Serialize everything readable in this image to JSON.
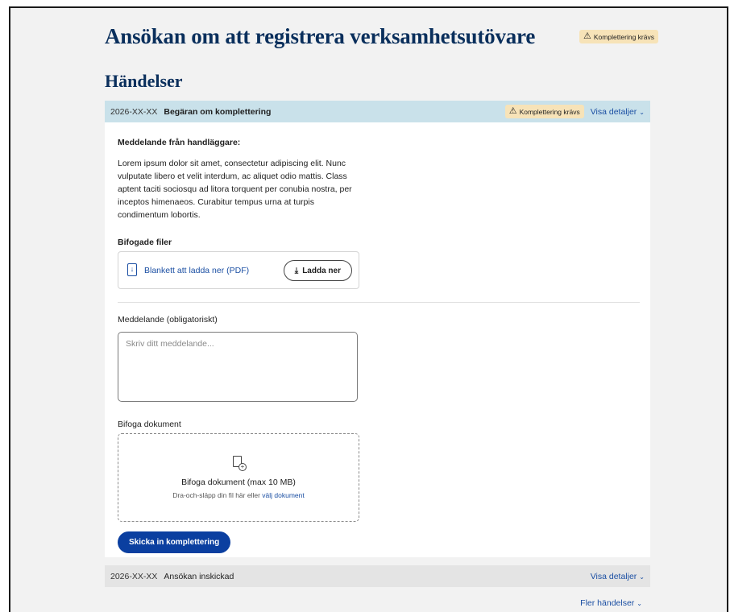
{
  "page": {
    "title": "Ansökan om att registrera verksamhetsutövare",
    "status_badge": "Komplettering krävs"
  },
  "events_section": {
    "title": "Händelser",
    "events": [
      {
        "date": "2026-XX-XX",
        "title": "Begäran om komplettering",
        "badge": "Komplettering krävs",
        "toggle_label": "Visa detaljer"
      },
      {
        "date": "2026-XX-XX",
        "title": "Ansökan inskickad",
        "toggle_label": "Visa detaljer"
      }
    ],
    "more_label": "Fler händelser"
  },
  "detail": {
    "message_heading": "Meddelande från handläggare:",
    "message_text": "Lorem ipsum dolor sit amet, consectetur adipiscing elit. Nunc vulputate libero et velit interdum, ac aliquet odio mattis. Class aptent taciti sociosqu ad litora torquent per conubia nostra, per inceptos himenaeos. Curabitur tempus urna at turpis condimentum lobortis.",
    "files_heading": "Bifogade filer",
    "file_link": "Blankett att ladda ner (PDF)",
    "download_label": "Ladda ner"
  },
  "form": {
    "message_label": "Meddelande (obligatoriskt)",
    "message_placeholder": "Skriv ditt meddelande...",
    "message_value": "",
    "attach_label": "Bifoga dokument",
    "dropzone_title": "Bifoga dokument (max 10 MB)",
    "dropzone_hint": "Dra-och-släpp din fil här eller",
    "dropzone_link": "välj dokument",
    "submit_label": "Skicka in komplettering"
  },
  "colors": {
    "title": "#0a2f5c",
    "link": "#1b4fa3",
    "primary_button": "#0b3fa0",
    "badge_bg": "#f7e3b8",
    "active_event_bg": "#c9e1ea"
  },
  "icons": {
    "warning": "warning-triangle-icon",
    "chevron": "chevron-down-icon",
    "file": "file-download-icon",
    "download": "download-icon",
    "attach": "file-add-icon"
  }
}
